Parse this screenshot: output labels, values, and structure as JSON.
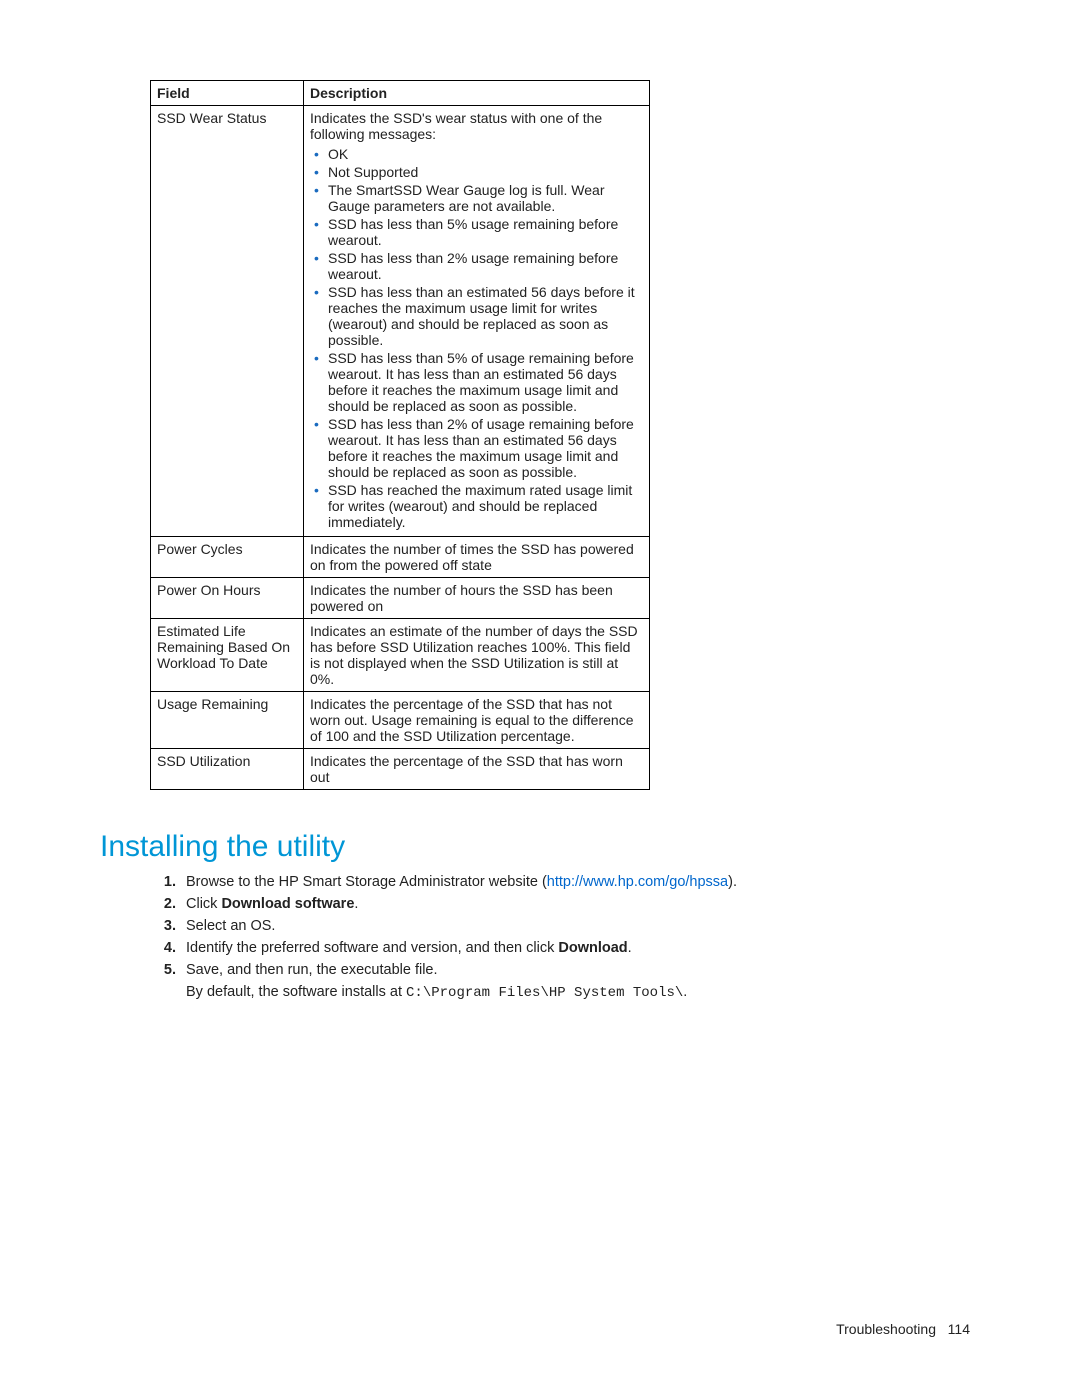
{
  "table": {
    "header": {
      "field": "Field",
      "desc": "Description"
    },
    "rows": [
      {
        "field": "SSD Wear Status",
        "intro": "Indicates the SSD's wear status with one of the following messages:",
        "bullets": [
          "OK",
          "Not Supported",
          "The SmartSSD Wear Gauge log is full. Wear Gauge parameters are not available.",
          "SSD has less than 5% usage remaining before wearout.",
          "SSD has less than 2% usage remaining before wearout.",
          "SSD has less than an estimated 56 days before it reaches the maximum usage limit for writes (wearout) and should be replaced as soon as possible.",
          "SSD has less than 5% of usage remaining before wearout. It has less than an estimated 56 days before it reaches the maximum usage limit and should be replaced as soon as possible.",
          "SSD has less than 2% of usage remaining before wearout. It has less than an estimated 56 days before it reaches the maximum usage limit and should be replaced as soon as possible.",
          "SSD has reached the maximum rated usage limit for writes (wearout) and should be replaced immediately."
        ]
      },
      {
        "field": "Power Cycles",
        "desc": "Indicates the number of times the SSD has powered on from the powered off state"
      },
      {
        "field": "Power On Hours",
        "desc": "Indicates the number of hours the SSD has been powered on"
      },
      {
        "field": "Estimated Life Remaining Based On Workload To Date",
        "desc": "Indicates an estimate of the number of days the SSD has before SSD Utilization reaches 100%. This field is not displayed when the SSD Utilization is still at 0%."
      },
      {
        "field": "Usage Remaining",
        "desc": "Indicates the percentage of the SSD that has not worn out. Usage remaining is equal to the difference of 100 and the SSD Utilization percentage."
      },
      {
        "field": "SSD Utilization",
        "desc": "Indicates the percentage of the SSD that has worn out"
      }
    ]
  },
  "section_heading": "Installing the utility",
  "steps": {
    "s1_pre": "Browse to the HP Smart Storage Administrator website (",
    "s1_link": "http://www.hp.com/go/hpssa",
    "s1_post": ").",
    "s2_pre": "Click ",
    "s2_bold": "Download software",
    "s2_post": ".",
    "s3": "Select an OS.",
    "s4_pre": "Identify the preferred software and version, and then click ",
    "s4_bold": "Download",
    "s4_post": ".",
    "s5": "Save, and then run, the executable file.",
    "s5b_pre": "By default, the software installs at ",
    "s5b_code": "C:\\Program Files\\HP System Tools\\",
    "s5b_post": "."
  },
  "footer": {
    "label": "Troubleshooting",
    "page": "114"
  }
}
